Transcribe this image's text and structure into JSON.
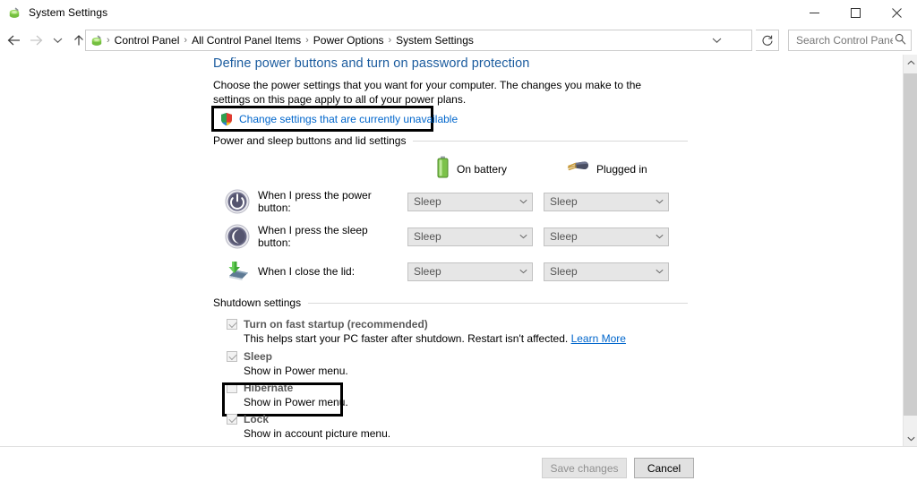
{
  "window": {
    "title": "System Settings",
    "app_icon": "power-options-icon",
    "controls": {
      "minimize": "minimize-icon",
      "maximize": "maximize-icon",
      "close": "close-icon"
    }
  },
  "address_bar": {
    "back": "back-arrow-icon",
    "forward": "forward-arrow-icon",
    "recent": "recent-pages-chevron-icon",
    "up": "up-arrow-icon",
    "breadcrumbs": [
      "Control Panel",
      "All Control Panel Items",
      "Power Options",
      "System Settings"
    ],
    "separator": "›",
    "dropdown": "chevron-down-icon",
    "refresh": "refresh-icon",
    "search_placeholder": "Search Control Panel",
    "search_value": "",
    "search_icon": "search-icon"
  },
  "page": {
    "title": "Define power buttons and turn on password protection",
    "description": "Choose the power settings that you want for your computer. The changes you make to the settings on this page apply to all of your power plans.",
    "uac_link": "Change settings that are currently unavailable",
    "uac_icon": "uac-shield-icon"
  },
  "power_section": {
    "label": "Power and sleep buttons and lid settings",
    "columns": [
      {
        "label": "On battery",
        "icon": "battery-icon"
      },
      {
        "label": "Plugged in",
        "icon": "power-plug-icon"
      }
    ],
    "rows": [
      {
        "icon": "power-button-icon",
        "label": "When I press the power button:",
        "on_battery": "Sleep",
        "plugged_in": "Sleep",
        "disabled": true
      },
      {
        "icon": "sleep-button-icon",
        "label": "When I press the sleep button:",
        "on_battery": "Sleep",
        "plugged_in": "Sleep",
        "disabled": true
      },
      {
        "icon": "close-lid-icon",
        "label": "When I close the lid:",
        "on_battery": "Sleep",
        "plugged_in": "Sleep",
        "disabled": true
      }
    ]
  },
  "shutdown_section": {
    "label": "Shutdown settings",
    "items": [
      {
        "label": "Turn on fast startup (recommended)",
        "checked": true,
        "disabled": true,
        "description": "This helps start your PC faster after shutdown. Restart isn't affected.",
        "link": "Learn More"
      },
      {
        "label": "Sleep",
        "checked": true,
        "disabled": true,
        "description": "Show in Power menu.",
        "link": ""
      },
      {
        "label": "Hibernate",
        "checked": false,
        "disabled": true,
        "description": "Show in Power menu.",
        "link": ""
      },
      {
        "label": "Lock",
        "checked": true,
        "disabled": true,
        "description": "Show in account picture menu.",
        "link": ""
      }
    ]
  },
  "scrollbar": {
    "up_arrow": "scroll-up-icon",
    "down_arrow": "scroll-down-icon"
  },
  "footer": {
    "save_label": "Save changes",
    "save_disabled": true,
    "cancel_label": "Cancel"
  },
  "colors": {
    "heading_blue": "#1a5b9e",
    "link_blue": "#0066cc",
    "battery_green": "#5ab02c",
    "annotation_black": "#000000",
    "disabled_grey": "#909090"
  }
}
